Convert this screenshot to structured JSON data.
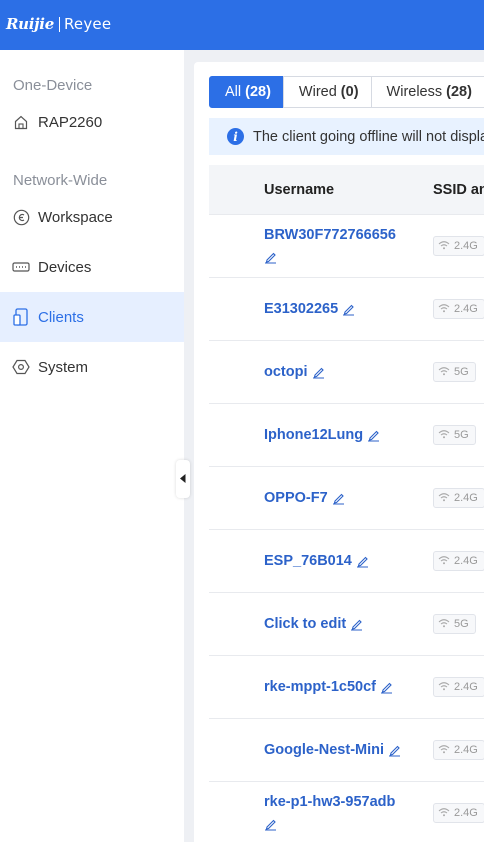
{
  "brand": {
    "left": "Ruijie",
    "right": "Reyee",
    "color": "#2c6fe6"
  },
  "sidebar": {
    "one_device_title": "One-Device",
    "device_name": "RAP2260",
    "network_wide_title": "Network-Wide",
    "items": [
      {
        "label": "Workspace",
        "icon": "workspace-icon"
      },
      {
        "label": "Devices",
        "icon": "devices-icon"
      },
      {
        "label": "Clients",
        "icon": "clients-icon",
        "active": true
      },
      {
        "label": "System",
        "icon": "system-icon"
      }
    ]
  },
  "tabs": [
    {
      "label": "All",
      "count": "(28)",
      "active": true
    },
    {
      "label": "Wired",
      "count": "(0)"
    },
    {
      "label": "Wireless",
      "count": "(28)"
    }
  ],
  "notice": "The client going offline will not display",
  "table": {
    "headers": {
      "username": "Username",
      "ssid": "SSID and Band"
    },
    "rows": [
      {
        "username": "BRW30F772766656",
        "band": "2.4G"
      },
      {
        "username": "E31302265",
        "band": "2.4G"
      },
      {
        "username": "octopi",
        "band": "5G"
      },
      {
        "username": "Iphone12Lung",
        "band": "5G"
      },
      {
        "username": "OPPO-F7",
        "band": "2.4G"
      },
      {
        "username": "ESP_76B014",
        "band": "2.4G"
      },
      {
        "username": "Click to edit",
        "band": "5G"
      },
      {
        "username": "rke-mppt-1c50cf",
        "band": "2.4G"
      },
      {
        "username": "Google-Nest-Mini",
        "band": "2.4G"
      },
      {
        "username": "rke-p1-hw3-957adb",
        "band": "2.4G"
      }
    ]
  }
}
